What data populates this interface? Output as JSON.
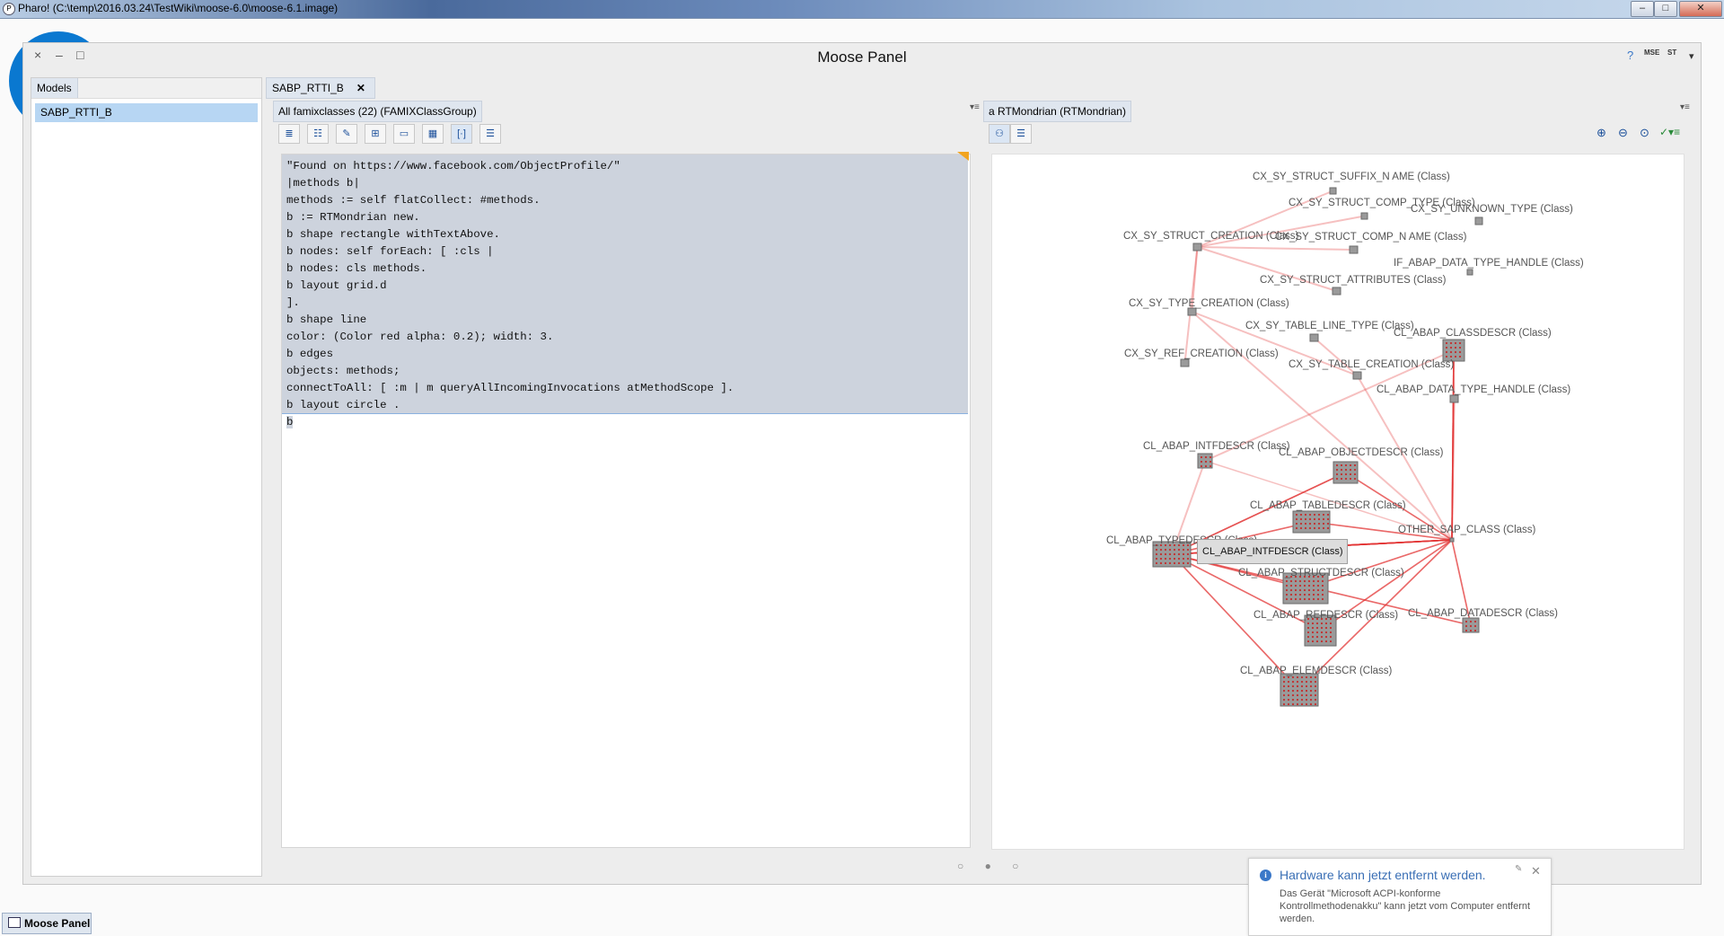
{
  "window": {
    "title": "Pharo! (C:\\temp\\2016.03.24\\TestWiki\\moose-6.0\\moose-6.1.image)"
  },
  "panel": {
    "title": "Moose Panel",
    "close_glyph": "×",
    "minimize_glyph": "–",
    "maximize_glyph": "□",
    "help_glyph": "?",
    "mse_label": "MSE",
    "st_label": "ST"
  },
  "models": {
    "header": "Models",
    "items": [
      "SABP_RTTI_B"
    ]
  },
  "editor_tab": {
    "label": "SABP_RTTI_B",
    "close": "✕"
  },
  "browser": {
    "group_label": "All famixclasses (22) (FAMIXClassGroup)"
  },
  "viz_tab": {
    "label": "a RTMondrian (RTMondrian)"
  },
  "code_lines": [
    "\"Found on https://www.facebook.com/ObjectProfile/\"",
    "|methods b|",
    "methods := self flatCollect: #methods.",
    "b := RTMondrian new.",
    "b shape rectangle withTextAbove.",
    "b nodes: self forEach: [ :cls |",
    "b nodes: cls methods.",
    "b layout grid.d",
    "].",
    "b shape line",
    "color: (Color red alpha: 0.2); width: 3.",
    "b edges",
    "objects: methods;",
    "connectToAll: [ :m | m queryAllIncomingInvocations atMethodScope ].",
    "b layout circle .",
    "b"
  ],
  "graph_nodes": [
    "CX_SY_STRUCT_SUFFIX_N AME (Class)",
    "CX_SY_STRUCT_COMP_TYPE (Class)",
    "CX_SY_UNKNOWN_TYPE (Class)",
    "CX_SY_STRUCT_CREATION (Class)",
    "CX_SY_STRUCT_COMP_N AME (Class)",
    "IF_ABAP_DATA_TYPE_HANDLE (Class)",
    "CX_SY_STRUCT_ATTRIBUTES (Class)",
    "CX_SY_TYPE_CREATION (Class)",
    "CX_SY_TABLE_LINE_TYPE (Class)",
    "CL_ABAP_CLASSDESCR (Class)",
    "CX_SY_REF_CREATION (Class)",
    "CX_SY_TABLE_CREATION (Class)",
    "CL_ABAP_DATA_TYPE_HANDLE (Class)",
    "CL_ABAP_INTFDESCR (Class)",
    "CL_ABAP_OBJECTDESCR (Class)",
    "CL_ABAP_TABLEDESCR (Class)",
    "OTHER_SAP_CLASS (Class)",
    "CL_ABAP_TYPEDESCR (Class)",
    "CL_ABAP_STRUCTDESCR (Class)",
    "CL_ABAP_REFDESCR (Class)",
    "CL_ABAP_DATADESCR (Class)",
    "CL_ABAP_ELEMDESCR (Class)"
  ],
  "tooltip": "CL_ABAP_INTFDESCR (Class)",
  "pager": "○ ● ○",
  "notification": {
    "title": "Hardware kann jetzt entfernt werden.",
    "body": "Das Gerät \"Microsoft ACPI-konforme Kontrollmethodenakku\" kann jetzt vom Computer entfernt werden."
  },
  "taskbar": {
    "item": "Moose Panel"
  },
  "colors": {
    "edge": "#e23030",
    "accent": "#0a78d0",
    "selection": "#b7d6f3"
  }
}
